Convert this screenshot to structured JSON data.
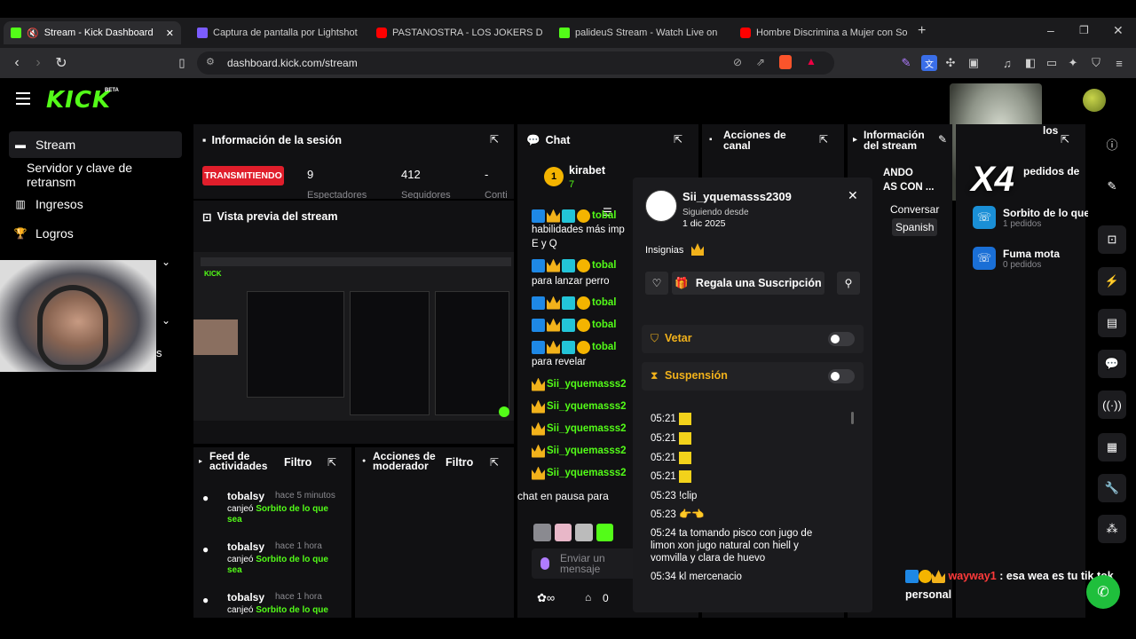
{
  "browser": {
    "tabs": [
      {
        "label": "Stream - Kick Dashboard",
        "icon": "kick-favicon"
      },
      {
        "label": "Captura de pantalla por Lightshot",
        "icon": "lightshot-favicon"
      },
      {
        "label": "PASTANOSTRA - LOS JOKERS DE LA B",
        "icon": "youtube-favicon"
      },
      {
        "label": "palideuS Stream - Watch Live on",
        "icon": "kick-favicon"
      },
      {
        "label": "Hombre Discrimina a Mujer con Sob",
        "icon": "youtube-favicon"
      }
    ],
    "url": "dashboard.kick.com/stream"
  },
  "header": {
    "logo": "KICK",
    "badge": "BETA"
  },
  "sidebar": {
    "items": [
      {
        "label": "Stream",
        "icon": "video-icon"
      },
      {
        "label": "Servidor y clave de retransm",
        "icon": ""
      },
      {
        "label": "Ingresos",
        "icon": "chart-icon"
      },
      {
        "label": "Logros",
        "icon": "trophy-icon"
      }
    ],
    "cut_text": "s"
  },
  "session": {
    "title": "Información de la sesión",
    "status": "TRANSMITIENDO",
    "stats": [
      "9",
      "412",
      "-"
    ],
    "stat_labels": [
      "Espectadores",
      "Seguidores",
      "Conti"
    ]
  },
  "preview": {
    "title": "Vista previa del stream"
  },
  "feed": {
    "title": "Feed de actividades",
    "filter": "Filtro",
    "items": [
      {
        "user": "tobalsy",
        "time": "hace 5 minutos",
        "action": "canjeó",
        "reward": "Sorbito de lo que sea"
      },
      {
        "user": "tobalsy",
        "time": "hace 1 hora",
        "action": "canjeó",
        "reward": "Sorbito de lo que sea"
      },
      {
        "user": "tobalsy",
        "time": "hace 1 hora",
        "action": "canjeó",
        "reward": "Sorbito de lo que sea"
      }
    ]
  },
  "modactions": {
    "title": "Acciones de moderador",
    "filter": "Filtro"
  },
  "chat": {
    "title": "Chat",
    "pinned_user": "kirabet",
    "pinned_sub": "7",
    "messages": [
      {
        "user": "tobal",
        "text": ""
      },
      {
        "user": "",
        "text": "habilidades más imp"
      },
      {
        "user": "",
        "text": "E y Q"
      },
      {
        "user": "tobal",
        "text": ""
      },
      {
        "user": "",
        "text": "para lanzar perro"
      },
      {
        "user": "tobal",
        "text": ""
      },
      {
        "user": "tobal",
        "text": ""
      },
      {
        "user": "tobal",
        "text": ""
      },
      {
        "user": "",
        "text": "para revelar"
      },
      {
        "user": "Sii_yquemasss2",
        "text": ""
      },
      {
        "user": "Sii_yquemasss2",
        "text": ""
      },
      {
        "user": "Sii_yquemasss2",
        "text": ""
      },
      {
        "user": "Sii_yquemasss2",
        "text": ""
      },
      {
        "user": "Sii_yquemasss2",
        "text": ""
      }
    ],
    "paused": "chat en pausa para",
    "input_placeholder": "Enviar un mensaje",
    "count": "0"
  },
  "channel_actions": {
    "title": "Acciones de canal"
  },
  "stream_info": {
    "title": "Información del stream",
    "line1": "ANDO",
    "line2": "AS CON ...",
    "category": "Conversar",
    "language": "Spanish"
  },
  "rewards": {
    "title": "los",
    "sub": "pedidos de",
    "items": [
      {
        "name": "Sorbito de lo que",
        "count": "1 pedidos",
        "color": "#1a8fd6"
      },
      {
        "name": "Fuma mota",
        "count": "0 pedidos",
        "color": "#1a6fd6"
      }
    ]
  },
  "usercard": {
    "username": "Sii_yquemasss2309",
    "following_label": "Siguiendo desde",
    "following_date": "1 dic 2025",
    "badges_label": "Insignias",
    "gift_button": "Regala una Suscripción",
    "ban_label": "Vetar",
    "timeout_label": "Suspensión",
    "log": [
      {
        "time": "05:21",
        "text": ""
      },
      {
        "time": "05:21",
        "text": ""
      },
      {
        "time": "05:21",
        "text": ""
      },
      {
        "time": "05:21",
        "text": ""
      },
      {
        "time": "05:23",
        "text": "!clip"
      },
      {
        "time": "05:23",
        "text": "👉👈"
      },
      {
        "time": "05:24",
        "text": "ta tomando pisco con jugo de"
      },
      {
        "time": "",
        "text": "limon xon jugo natural con hiell y"
      },
      {
        "time": "",
        "text": "vomvilla y clara de huevo"
      },
      {
        "time": "05:34",
        "text": "kl mercenacio"
      }
    ]
  },
  "overlay": {
    "user": "wayway1",
    "text": ": esa wea es tu tik tok",
    "text2": "personal",
    "x4": "X4"
  }
}
